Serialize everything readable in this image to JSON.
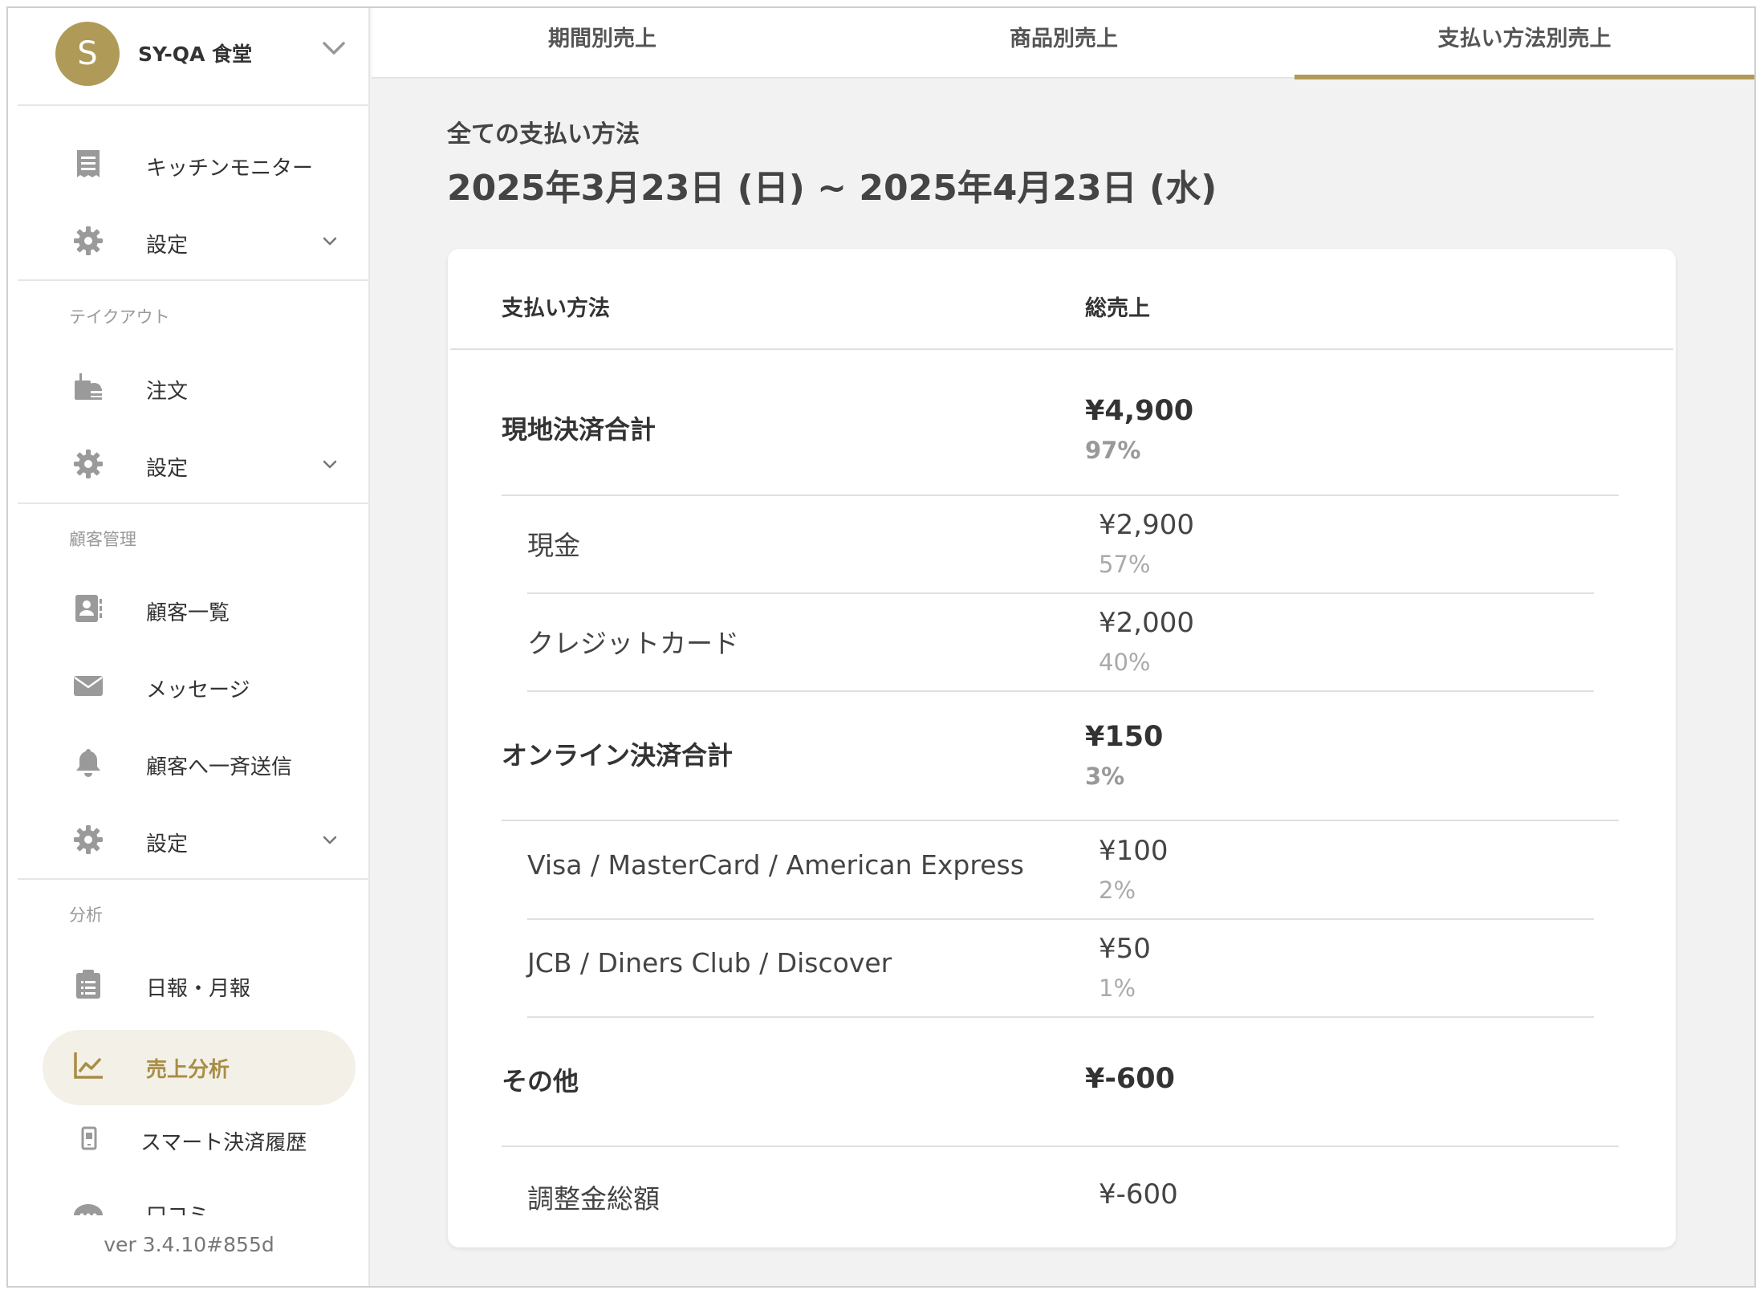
{
  "colors": {
    "accent": "#b09a58",
    "active_bg": "#f3f0e8"
  },
  "store": {
    "initial": "S",
    "name": "SY-QA 食堂"
  },
  "sidebar": {
    "items": [
      {
        "label": "キッチンモニター",
        "icon": "receipt-icon"
      },
      {
        "label": "設定",
        "icon": "gear-icon"
      },
      {
        "label": "注文",
        "icon": "takeout-icon"
      },
      {
        "label": "設定",
        "icon": "gear-icon"
      },
      {
        "label": "顧客一覧",
        "icon": "contact-card-icon"
      },
      {
        "label": "メッセージ",
        "icon": "envelope-icon"
      },
      {
        "label": "顧客へ一斉送信",
        "icon": "bell-icon"
      },
      {
        "label": "設定",
        "icon": "gear-icon"
      },
      {
        "label": "日報・月報",
        "icon": "clipboard-icon"
      },
      {
        "label": "売上分析",
        "icon": "line-chart-icon",
        "active": true
      },
      {
        "label": "スマート決済履歴",
        "icon": "mobile-payment-icon"
      },
      {
        "label": "口コミ",
        "icon": "review-icon"
      }
    ],
    "sections": [
      "テイクアウト",
      "顧客管理",
      "分析"
    ],
    "version": "ver 3.4.10#855d"
  },
  "tabs": [
    {
      "label": "期間別売上"
    },
    {
      "label": "商品別売上"
    },
    {
      "label": "支払い方法別売上",
      "active": true
    }
  ],
  "main": {
    "heading": "全ての支払い方法",
    "date_range": "2025年3月23日 (日) ~ 2025年4月23日 (水)"
  },
  "table": {
    "col_method": "支払い方法",
    "col_total": "総売上",
    "rows": [
      {
        "label": "現地決済合計",
        "amount": "¥4,900",
        "percent": "97%"
      },
      {
        "label": "現金",
        "amount": "¥2,900",
        "percent": "57%"
      },
      {
        "label": "クレジットカード",
        "amount": "¥2,000",
        "percent": "40%"
      },
      {
        "label": "オンライン決済合計",
        "amount": "¥150",
        "percent": "3%"
      },
      {
        "label": "Visa / MasterCard / American Express",
        "amount": "¥100",
        "percent": "2%"
      },
      {
        "label": "JCB / Diners Club / Discover",
        "amount": "¥50",
        "percent": "1%"
      },
      {
        "label": "その他",
        "amount": "¥-600"
      },
      {
        "label": "調整金総額",
        "amount": "¥-600"
      }
    ]
  }
}
